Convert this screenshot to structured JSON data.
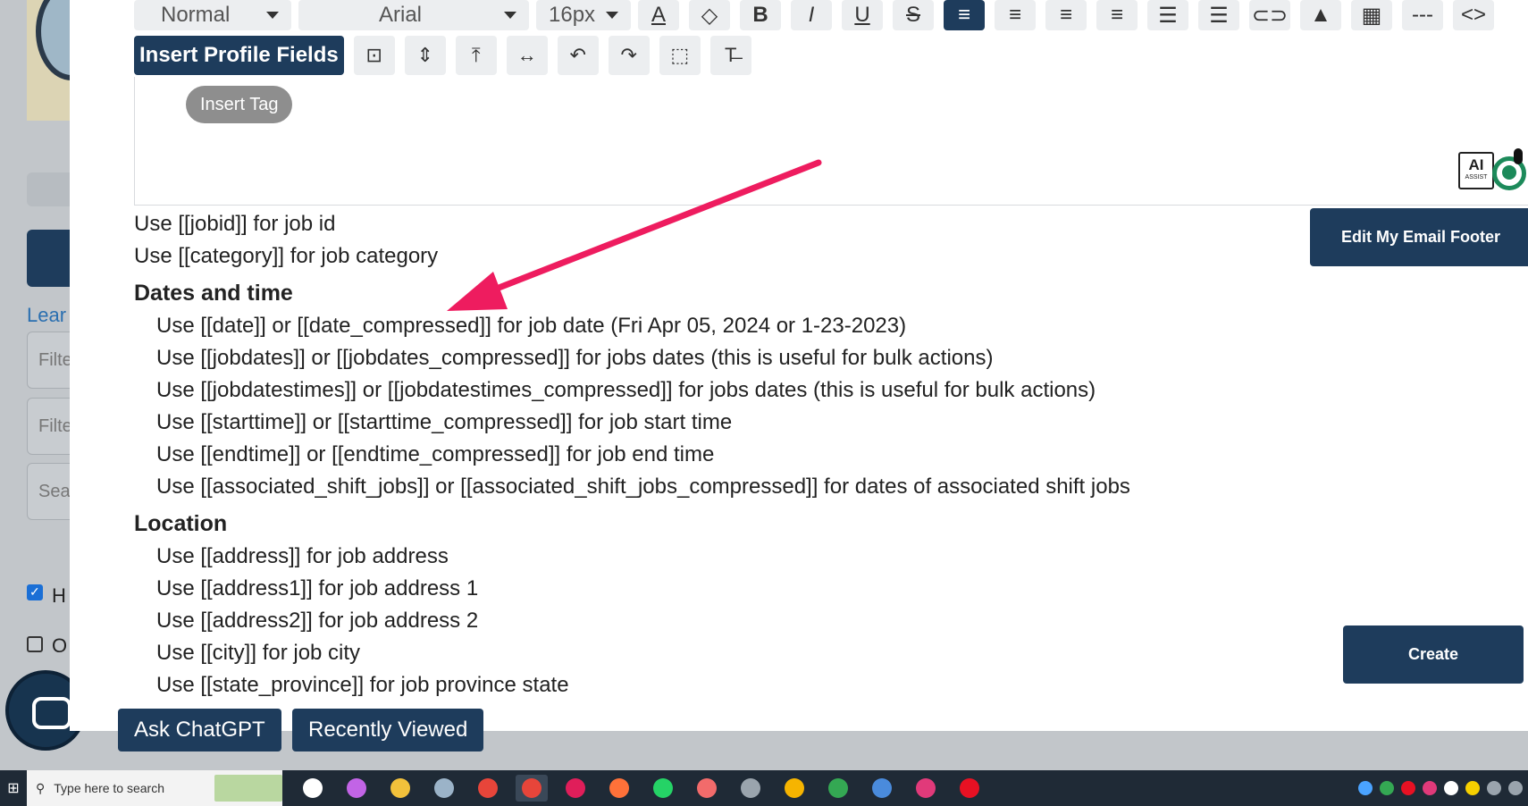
{
  "background": {
    "learn_link": "Lear",
    "filter_placeholder_1": "Filte",
    "filter_placeholder_2": "Filte",
    "search_placeholder": "Sea",
    "checkbox_1_label": "H",
    "checkbox_1_checked": true,
    "checkbox_2_label": "O",
    "checkbox_2_checked": false
  },
  "toolbar": {
    "paragraph_style": "Normal",
    "font_family": "Arial",
    "font_size": "16px",
    "buttons": [
      {
        "name": "font-color-icon",
        "glyph": "A"
      },
      {
        "name": "highlight-icon",
        "glyph": "◇"
      },
      {
        "name": "bold-icon",
        "glyph": "B"
      },
      {
        "name": "italic-icon",
        "glyph": "I"
      },
      {
        "name": "underline-icon",
        "glyph": "U"
      },
      {
        "name": "strikethrough-icon",
        "glyph": "S"
      },
      {
        "name": "align-left-icon",
        "glyph": "≡"
      },
      {
        "name": "align-center-icon",
        "glyph": "≡"
      },
      {
        "name": "align-right-icon",
        "glyph": "≡"
      },
      {
        "name": "align-justify-icon",
        "glyph": "≡"
      },
      {
        "name": "bullet-list-icon",
        "glyph": "☰"
      },
      {
        "name": "numbered-list-icon",
        "glyph": "☰"
      },
      {
        "name": "link-icon",
        "glyph": "⊂⊃"
      },
      {
        "name": "image-icon",
        "glyph": "▲"
      },
      {
        "name": "table-icon",
        "glyph": "▦"
      },
      {
        "name": "horizontal-rule-icon",
        "glyph": "---"
      },
      {
        "name": "code-view-icon",
        "glyph": "<>"
      }
    ],
    "insert_profile_fields_label": "Insert Profile Fields",
    "row2_buttons": [
      {
        "name": "select-cell-icon",
        "glyph": "⊡"
      },
      {
        "name": "expand-vertical-icon",
        "glyph": "⇕"
      },
      {
        "name": "collapse-vertical-icon",
        "glyph": "⤒"
      },
      {
        "name": "expand-horizontal-icon",
        "glyph": "↔"
      },
      {
        "name": "undo-icon",
        "glyph": "↶"
      },
      {
        "name": "redo-icon",
        "glyph": "↷"
      },
      {
        "name": "select-all-icon",
        "glyph": "⬚"
      },
      {
        "name": "clear-format-icon",
        "glyph": "T̶"
      }
    ],
    "tooltip": "Insert Tag"
  },
  "ai_assist": {
    "label": "AI",
    "sub": "ASSIST"
  },
  "help": {
    "intro_lines": [
      "Use [[jobid]] for job id",
      "Use [[category]] for job category"
    ],
    "sections": [
      {
        "heading": "Dates and time",
        "lines": [
          "Use [[date]] or [[date_compressed]] for job date (Fri Apr 05, 2024 or 1-23-2023)",
          "Use [[jobdates]] or [[jobdates_compressed]] for jobs dates (this is useful for bulk actions)",
          "Use [[jobdatestimes]] or [[jobdatestimes_compressed]] for jobs dates (this is useful for bulk actions)",
          "Use [[starttime]] or [[starttime_compressed]] for job start time",
          "Use [[endtime]] or [[endtime_compressed]] for job end time",
          "Use [[associated_shift_jobs]] or [[associated_shift_jobs_compressed]] for dates of associated shift jobs"
        ]
      },
      {
        "heading": "Location",
        "lines": [
          "Use [[address]] for job address",
          "Use [[address1]] for job address 1",
          "Use [[address2]] for job address 2",
          "Use [[city]] for job city",
          "Use [[state_province]] for job province state"
        ]
      }
    ]
  },
  "actions": {
    "edit_footer_label": "Edit My Email Footer",
    "create_label": "Create"
  },
  "floating": {
    "ask_chatgpt": "Ask ChatGPT",
    "recently_viewed": "Recently Viewed"
  },
  "taskbar": {
    "search_placeholder": "Type here to search",
    "apps": [
      {
        "name": "task-view-icon",
        "color": "#ffffff"
      },
      {
        "name": "copilot-icon",
        "color": "#c264e6"
      },
      {
        "name": "file-explorer-icon",
        "color": "#f2c13b"
      },
      {
        "name": "app-bird-icon",
        "color": "#9bb3c8"
      },
      {
        "name": "chrome-icon",
        "color": "#e7453a"
      },
      {
        "name": "chrome-active-icon",
        "color": "#e7453a"
      },
      {
        "name": "slack-icon",
        "color": "#e01e5a"
      },
      {
        "name": "firefox-icon",
        "color": "#ff7139"
      },
      {
        "name": "whatsapp-icon",
        "color": "#25d366"
      },
      {
        "name": "paint-icon",
        "color": "#f26b6b"
      },
      {
        "name": "clock-icon",
        "color": "#9aa4ad"
      },
      {
        "name": "chrome-canary-icon",
        "color": "#f6b400"
      },
      {
        "name": "chrome-profile-icon",
        "color": "#34a853"
      },
      {
        "name": "calculator-icon",
        "color": "#4a8bdc"
      },
      {
        "name": "app-pink-icon",
        "color": "#e13a7a"
      },
      {
        "name": "record-icon",
        "color": "#e81123"
      }
    ],
    "tray": [
      "#4aa3ff",
      "#34a853",
      "#e81123",
      "#e13a7a",
      "#ffffff",
      "#f6d000",
      "#9aa4ad",
      "#9aa4ad"
    ]
  },
  "colors": {
    "primary": "#1e3c5c",
    "arrow": "#ee1c5f"
  }
}
